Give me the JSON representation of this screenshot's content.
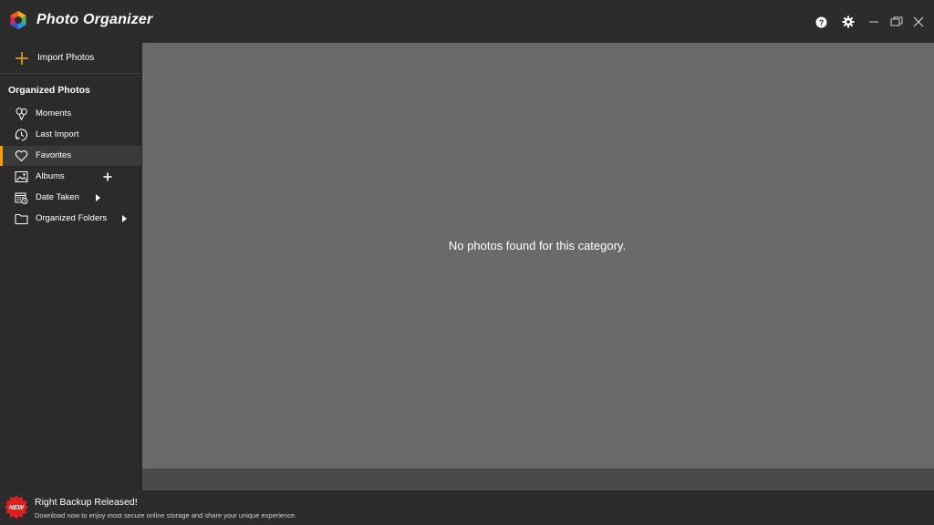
{
  "titlebar": {
    "app_title": "Photo Organizer",
    "logo_icon": "app-logo-icon",
    "controls": [
      "help-icon",
      "gear-icon",
      "minimize-icon",
      "restore-icon",
      "close-icon"
    ]
  },
  "sidebar": {
    "import_label": "Import Photos",
    "import_icon": "plus-icon",
    "section_title": "Organized Photos",
    "items": [
      {
        "label": "Moments",
        "icon": "balloons-icon"
      },
      {
        "label": "Last Import",
        "icon": "clock-import-icon"
      },
      {
        "label": "Favorites",
        "icon": "heart-icon",
        "active": true
      },
      {
        "label": "Albums",
        "icon": "image-icon",
        "extra": "plus-icon"
      },
      {
        "label": "Date Taken",
        "icon": "calendar-icon",
        "extra": "chevron-right-icon"
      },
      {
        "label": "Organized Folders",
        "icon": "folder-icon",
        "extra": "chevron-right-icon"
      }
    ],
    "accent_color": "#f5a000"
  },
  "main": {
    "empty_message": "No photos found for this category."
  },
  "promo": {
    "badge_text": "NEW",
    "title": "Right Backup Released!",
    "subtitle": "Download now to enjoy most secure online storage and share your unique experience."
  }
}
